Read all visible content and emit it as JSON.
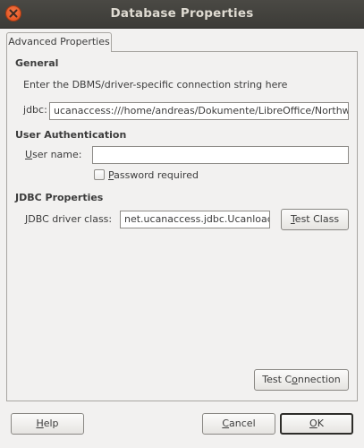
{
  "window": {
    "title": "Database Properties"
  },
  "tabs": [
    {
      "label": "Advanced Properties",
      "selected": true
    }
  ],
  "general": {
    "heading": "General",
    "description": "Enter the DBMS/driver-specific connection string here",
    "jdbc_label_mnemonic": "j",
    "jdbc_label_rest": "dbc:",
    "jdbc_value": "ucanaccess:///home/andreas/Dokumente/LibreOffice/Northwind"
  },
  "user_auth": {
    "heading": "User Authentication",
    "username_label_mnemonic": "U",
    "username_label_rest": "ser name:",
    "username_value": "",
    "password_required_mnemonic": "P",
    "password_required_rest": "assword required",
    "password_required_checked": false
  },
  "jdbc_properties": {
    "heading": "JDBC Properties",
    "driver_label_pre": "",
    "driver_label_mnemonic": "J",
    "driver_label_rest": "DBC driver class:",
    "driver_value": "net.ucanaccess.jdbc.UcanloadDriver",
    "test_class_pre": "",
    "test_class_mnemonic": "T",
    "test_class_rest": "est Class"
  },
  "test_connection": {
    "pre": "Test C",
    "mnemonic": "o",
    "rest": "nnection"
  },
  "footer": {
    "help_mnemonic": "H",
    "help_rest": "elp",
    "cancel_mnemonic": "C",
    "cancel_rest": "ancel",
    "ok_mnemonic": "O",
    "ok_rest": "K"
  },
  "colors": {
    "titlebar": "#3c3b37",
    "title_text": "#dfdbd2",
    "close_button": "#df4a16",
    "dialog_bg": "#f2f1f0"
  },
  "icons": {
    "close": "close-icon"
  }
}
